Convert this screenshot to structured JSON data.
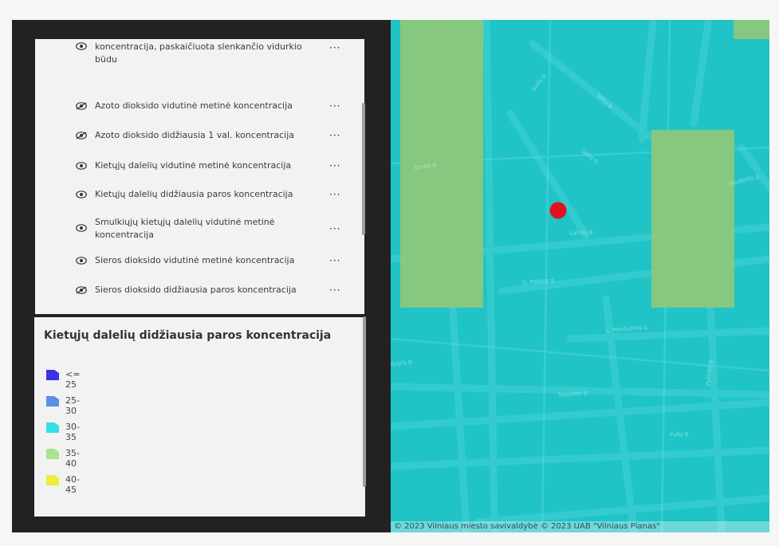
{
  "layers": {
    "items": [
      {
        "label": "koncentracija, paskaičiuota slenkančio vidurkio būdu",
        "more": "···"
      },
      {
        "label": "Azoto dioksido vidutinė metinė koncentracija",
        "more": "···"
      },
      {
        "label": "Azoto dioksido didžiausia 1 val. koncentracija",
        "more": "···"
      },
      {
        "label": "Kietųjų dalelių vidutinė metinė koncentracija",
        "more": "···"
      },
      {
        "label": "Kietųjų dalelių didžiausia paros koncentracija",
        "more": "···"
      },
      {
        "label": "Smulkiųjų kietųjų dalelių vidutinė metinė koncentracija",
        "more": "···"
      },
      {
        "label": "Sieros dioksido vidutinė metinė koncentracija",
        "more": "···"
      },
      {
        "label": "Sieros dioksido didžiausia paros koncentracija",
        "more": "···"
      }
    ]
  },
  "legend": {
    "title": "Kietųjų dalelių didžiausia paros koncentracija",
    "items": [
      {
        "label": "<= 25",
        "color": "#3a32e6"
      },
      {
        "label": "25-30",
        "color": "#5b8fe8"
      },
      {
        "label": "30-35",
        "color": "#33e0e6"
      },
      {
        "label": "35-40",
        "color": "#a8e58c"
      },
      {
        "label": "40-45",
        "color": "#eeec3c"
      }
    ]
  },
  "map": {
    "background_color": "#20c4c6",
    "zone_color": "#8fc879",
    "marker_color": "#e3121c",
    "street_labels": [
      "Sodų g.",
      "Gėlių g.",
      "Bėrąg g.",
      "Latvių g.",
      "D. Poškos g.",
      "L. Montuškos g.",
      "Trenutos g.",
      "Pušų g.",
      "Tulpių g.",
      "Studentų g.",
      "Vykinto g.",
      "Sėlių g."
    ],
    "attribution": "© 2023 Vilniaus miesto savivaldybė © 2023 UAB \"Vilniaus Planas\""
  }
}
